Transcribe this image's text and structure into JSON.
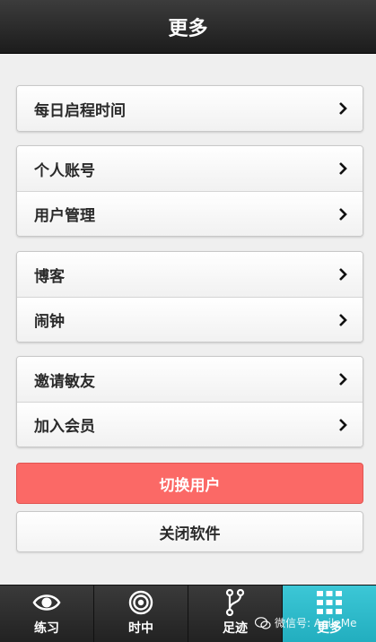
{
  "header": {
    "title": "更多"
  },
  "groups": [
    {
      "items": [
        {
          "label": "每日启程时间"
        }
      ]
    },
    {
      "items": [
        {
          "label": "个人账号"
        },
        {
          "label": "用户管理"
        }
      ]
    },
    {
      "items": [
        {
          "label": "博客"
        },
        {
          "label": "闹钟"
        }
      ]
    },
    {
      "items": [
        {
          "label": "邀请敏友"
        },
        {
          "label": "加入会员"
        }
      ]
    }
  ],
  "buttons": {
    "switch_user": "切换用户",
    "close_app": "关闭软件"
  },
  "tabs": [
    {
      "label": "练习",
      "icon": "eye-icon"
    },
    {
      "label": "时中",
      "icon": "target-icon"
    },
    {
      "label": "足迹",
      "icon": "branch-icon"
    },
    {
      "label": "更多",
      "icon": "grid-icon",
      "active": true
    }
  ],
  "watermark": {
    "text": "微信号: AgileMe"
  },
  "colors": {
    "accent": "#fb6966",
    "active_tab": "#2fbccc",
    "header": "#2a2a2a"
  }
}
